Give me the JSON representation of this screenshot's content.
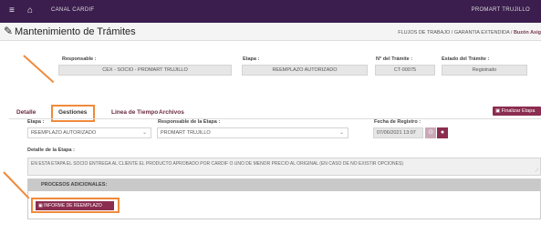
{
  "topbar": {
    "menu_icon": "hamburger-icon",
    "home_icon": "home-icon",
    "brand": "CANAL CARDIF",
    "user": "PROMART TRUJILLO"
  },
  "header": {
    "icon": "edit-icon",
    "title": "Mantenimiento de Trámites",
    "breadcrumb_prefix": "FLUJOS DE TRABAJO / GARANTIA EXTENDIDA / ",
    "breadcrumb_current": "Buzón Asig"
  },
  "summary": {
    "responsable_label": "Responsable :",
    "responsable_value": "CEX - SOCIO - PROMART TRUJILLO",
    "etapa_label": "Etapa :",
    "etapa_value": "REEMPLAZO AUTORIZADO",
    "tramite_label": "N° del Trámite :",
    "tramite_value": "CT-00075",
    "estado_label": "Estado del Trámite :",
    "estado_value": "Registrado"
  },
  "tabs": [
    {
      "label": "Detalle"
    },
    {
      "label": "Gestiones"
    },
    {
      "label": "Linea de Tiempo"
    },
    {
      "label": "Archivos"
    }
  ],
  "actions": {
    "finalizar_label": "Finalizar Etapa"
  },
  "form": {
    "etapa_label": "Etapa :",
    "etapa_value": "REEMPLAZO AUTORIZADO",
    "resp_etapa_label": "Responsable de la Etapa :",
    "resp_etapa_value": "PROMART TRUJILLO",
    "fecha_label": "Fecha de Registro :",
    "fecha_value": "07/06/2021 13:07",
    "detalle_label": "Detalle de la Etapa :",
    "detalle_value": "EN ESTA ETAPA EL SOCIO ENTREGA AL CLIENTE EL PRODUCTO APROBADO POR CARDIF O UNO DE MENOR PRECIO AL ORIGINAL (EN CASO DE NO EXISTIR OPCIONES)"
  },
  "procesos": {
    "header": "PROCESOS ADICIONALES:",
    "button_label": "INFORME DE REEMPLAZO"
  },
  "colors": {
    "topbar": "#3b1e4e",
    "primary": "#8b2d4f",
    "highlight": "#f08a3a"
  }
}
